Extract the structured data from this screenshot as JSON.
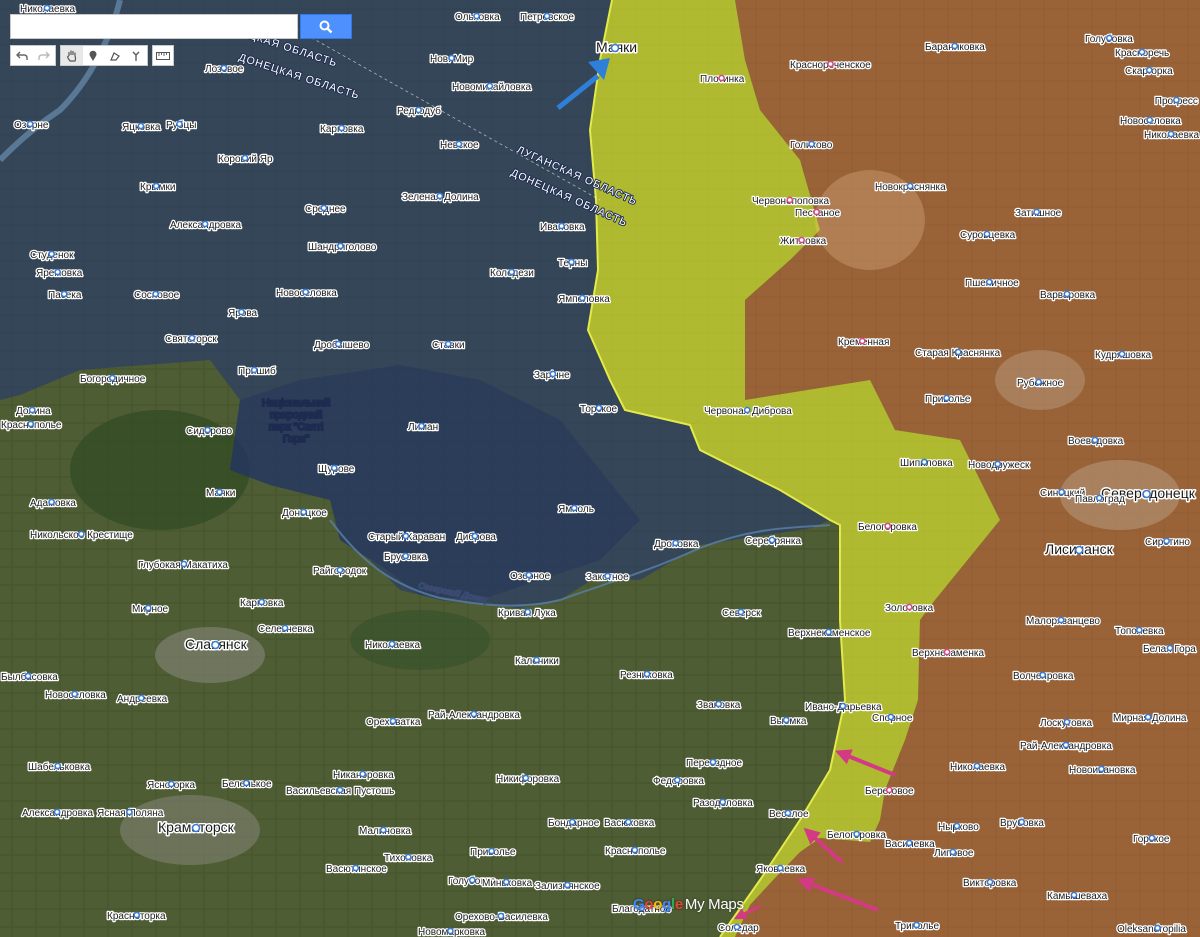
{
  "toolbar": {
    "search_placeholder": "",
    "search_icon": "search-icon",
    "tools": [
      "undo-icon",
      "redo-icon",
      "hand-icon",
      "marker-icon",
      "polygon-icon",
      "route-icon",
      "ruler-icon"
    ]
  },
  "regions": {
    "donetsk_top": "ДОНЕЦКАЯ ОБЛАСТЬ",
    "donetsk_top_cut": "ЦКАЯ ОБЛАСТЬ",
    "lugansk": "ЛУГАНСКАЯ ОБЛАСТЬ",
    "donetsk_right": "ДОНЕЦКАЯ ОБЛАСТЬ"
  },
  "park_label": [
    "Національний",
    "природний",
    "парк \"Святі",
    "Гори\""
  ],
  "river_label": "Северский Донец",
  "places": [
    {
      "name": "Николаевка"
    },
    {
      "name": "Ольховка"
    },
    {
      "name": "Петровское"
    },
    {
      "name": "Маяки"
    },
    {
      "name": "Лозовое"
    },
    {
      "name": "Нов. Мир"
    },
    {
      "name": "Новомихайловка"
    },
    {
      "name": "Плотинка"
    },
    {
      "name": "Бараниковка"
    },
    {
      "name": "Голубовка"
    },
    {
      "name": "Красноречь"
    },
    {
      "name": "Краснореченское"
    },
    {
      "name": "Скаргорка"
    },
    {
      "name": "Прогресс"
    },
    {
      "name": "Озерне"
    },
    {
      "name": "Яцковка"
    },
    {
      "name": "Рубцы"
    },
    {
      "name": "Редкодуб"
    },
    {
      "name": "Карповка"
    },
    {
      "name": "Новоселовка"
    },
    {
      "name": "Невское"
    },
    {
      "name": "Голиково"
    },
    {
      "name": "Коровий Яр"
    },
    {
      "name": "Новокраснянка"
    },
    {
      "name": "Николаевка"
    },
    {
      "name": "Крымки"
    },
    {
      "name": "Зеленая Долина"
    },
    {
      "name": "Червонопоповка"
    },
    {
      "name": "Песчаное"
    },
    {
      "name": "Затишное"
    },
    {
      "name": "Александровка"
    },
    {
      "name": "Среднее"
    },
    {
      "name": "Ивановка"
    },
    {
      "name": "Житловка"
    },
    {
      "name": "Суровцевка"
    },
    {
      "name": "Студенок"
    },
    {
      "name": "Шандриголово"
    },
    {
      "name": "Яремовка"
    },
    {
      "name": "Колодези"
    },
    {
      "name": "Терны"
    },
    {
      "name": "Пшеничное"
    },
    {
      "name": "Пасека"
    },
    {
      "name": "Сосновое"
    },
    {
      "name": "Новоселовка"
    },
    {
      "name": "Ямполовка"
    },
    {
      "name": "Варваровка"
    },
    {
      "name": "Ярова"
    },
    {
      "name": "Святогорск"
    },
    {
      "name": "Дробышево"
    },
    {
      "name": "Ставки"
    },
    {
      "name": "Кременная"
    },
    {
      "name": "Старая Краснянка"
    },
    {
      "name": "Кудряшовка"
    },
    {
      "name": "Богородичное"
    },
    {
      "name": "Пришиб"
    },
    {
      "name": "Зарічне"
    },
    {
      "name": "Рубежное"
    },
    {
      "name": "Долина"
    },
    {
      "name": "Краснополье"
    },
    {
      "name": "Торское"
    },
    {
      "name": "Червоная Диброва"
    },
    {
      "name": "Привольe"
    },
    {
      "name": "Сидорово"
    },
    {
      "name": "Лиман"
    },
    {
      "name": "Воеводовка"
    },
    {
      "name": "Адамовка"
    },
    {
      "name": "Маяки"
    },
    {
      "name": "Щурове"
    },
    {
      "name": "Шипиловка"
    },
    {
      "name": "Новодружеск"
    },
    {
      "name": "Синецкий"
    },
    {
      "name": "Северодонецк"
    },
    {
      "name": "Никольское Крестище"
    },
    {
      "name": "Донецкое"
    },
    {
      "name": "Ямполь"
    },
    {
      "name": "Павлоград"
    },
    {
      "name": "Белогоровка"
    },
    {
      "name": "Лисичанск"
    },
    {
      "name": "Сиротино"
    },
    {
      "name": "Глубокая Макатиха"
    },
    {
      "name": "Старый Караван"
    },
    {
      "name": "Диброва"
    },
    {
      "name": "Дроновка"
    },
    {
      "name": "Серебрянка"
    },
    {
      "name": "Карповка"
    },
    {
      "name": "Райгородок"
    },
    {
      "name": "Брусовка"
    },
    {
      "name": "Озерное"
    },
    {
      "name": "Закотное"
    },
    {
      "name": "Мирное"
    },
    {
      "name": "Селезневка"
    },
    {
      "name": "Кривая Лука"
    },
    {
      "name": "Северск"
    },
    {
      "name": "Золотовка"
    },
    {
      "name": "Малорязанцево"
    },
    {
      "name": "Славянск"
    },
    {
      "name": "Николаевка"
    },
    {
      "name": "Верхнекаменское"
    },
    {
      "name": "Тополевка"
    },
    {
      "name": "Каленики"
    },
    {
      "name": "Верхнекаменка"
    },
    {
      "name": "Белая Гора"
    },
    {
      "name": "Былбасовка"
    },
    {
      "name": "Резниковка"
    },
    {
      "name": "Волчеяровка"
    },
    {
      "name": "Новоселовка"
    },
    {
      "name": "Андреевка"
    },
    {
      "name": "Звановка"
    },
    {
      "name": "Ивано-Дарьевка"
    },
    {
      "name": "Лоскутовка"
    },
    {
      "name": "Ореховатка"
    },
    {
      "name": "Рай-Александровка"
    },
    {
      "name": "Выемка"
    },
    {
      "name": "Спорное"
    },
    {
      "name": "Мирная Долина"
    },
    {
      "name": "Рай-Александровка"
    },
    {
      "name": "Шабельковка"
    },
    {
      "name": "Переездное"
    },
    {
      "name": "Никаноровка"
    },
    {
      "name": "Николаевка"
    },
    {
      "name": "Новоивановка"
    },
    {
      "name": "Ясногорка"
    },
    {
      "name": "Беленькое"
    },
    {
      "name": "Никифоровка"
    },
    {
      "name": "Федоровка"
    },
    {
      "name": "Береговое"
    },
    {
      "name": "Александровка"
    },
    {
      "name": "Ясная Поляна"
    },
    {
      "name": "Васильевская Пустошь"
    },
    {
      "name": "Разодоловка"
    },
    {
      "name": "Врубовка"
    },
    {
      "name": "Краматорск"
    },
    {
      "name": "Малиновка"
    },
    {
      "name": "Бондарное"
    },
    {
      "name": "Васюковка"
    },
    {
      "name": "Веселое"
    },
    {
      "name": "Нырково"
    },
    {
      "name": "Белогоровка"
    },
    {
      "name": "Горское"
    },
    {
      "name": "Приволье"
    },
    {
      "name": "Краснополье"
    },
    {
      "name": "Василевка"
    },
    {
      "name": "Липовое"
    },
    {
      "name": "Тихоновка"
    },
    {
      "name": "Васютинское"
    },
    {
      "name": "Голубовка"
    },
    {
      "name": "Яковлевка"
    },
    {
      "name": "Зализнянское"
    },
    {
      "name": "Миньковка"
    },
    {
      "name": "Викторовка"
    },
    {
      "name": "Камышеваха"
    },
    {
      "name": "Красноторка"
    },
    {
      "name": "Орехово-Василевка"
    },
    {
      "name": "Благодатное"
    },
    {
      "name": "Трипольe"
    },
    {
      "name": "Оleksandropilia"
    },
    {
      "name": "Новомарковка"
    },
    {
      "name": "Соледар"
    }
  ],
  "attribution": {
    "google": "Google",
    "product": "My Maps"
  },
  "colors": {
    "occupied_fill": "#c98a48",
    "gray_zone_fill": "#d3dc2c",
    "donetsk_region_fill": "#2a3f78",
    "arrow_blue": "#2f7fd8",
    "arrow_magenta": "#d43a84",
    "search_button": "#4d90fe"
  }
}
